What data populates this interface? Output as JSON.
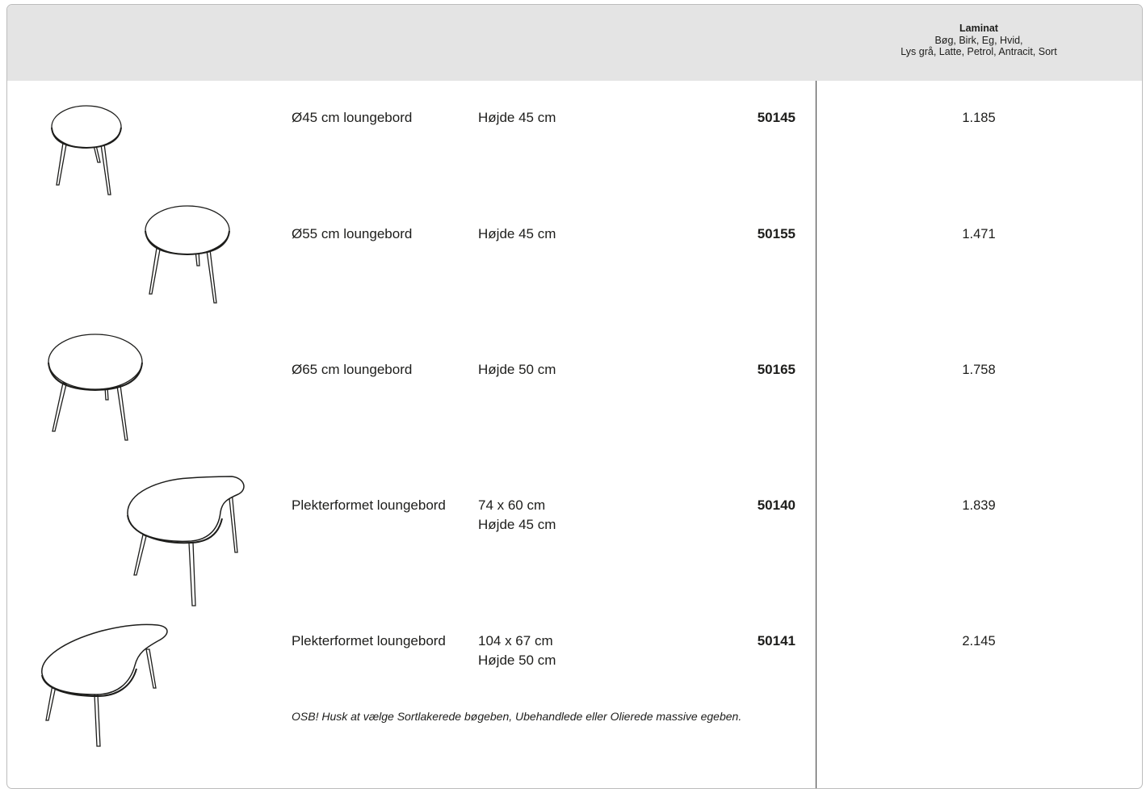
{
  "header": {
    "title": "Laminat",
    "colors_line1": "Bøg, Birk, Eg, Hvid,",
    "colors_line2": "Lys grå, Latte, Petrol, Antracit, Sort"
  },
  "products": [
    {
      "name": "Ø45 cm loungebord",
      "dims": [
        "Højde 45 cm"
      ],
      "code": "50145",
      "price": "1.185",
      "icon": "round-table-icon"
    },
    {
      "name": "Ø55 cm loungebord",
      "dims": [
        "Højde 45 cm"
      ],
      "code": "50155",
      "price": "1.471",
      "icon": "round-table-icon"
    },
    {
      "name": "Ø65 cm loungebord",
      "dims": [
        "Højde 50 cm"
      ],
      "code": "50165",
      "price": "1.758",
      "icon": "round-table-icon"
    },
    {
      "name": "Plekterformet loungebord",
      "dims": [
        "74 x 60 cm",
        "Højde 45 cm"
      ],
      "code": "50140",
      "price": "1.839",
      "icon": "kidney-table-icon"
    },
    {
      "name": "Plekterformet loungebord",
      "dims": [
        "104 x 67 cm",
        "Højde 50 cm"
      ],
      "code": "50141",
      "price": "2.145",
      "icon": "kidney-table-icon"
    }
  ],
  "note": "OSB! Husk at vælge Sortlakerede bøgeben, Ubehandlede eller Olierede massive egeben."
}
